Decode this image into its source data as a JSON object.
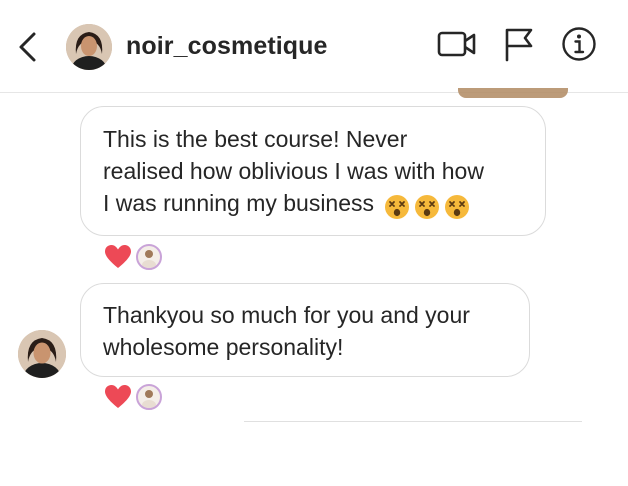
{
  "header": {
    "username": "noir_cosmetique",
    "icons": [
      "back-chevron-icon",
      "video-call-icon",
      "flag-icon",
      "info-icon"
    ]
  },
  "messages": [
    {
      "lines": [
        "This is the best course! Never",
        "realised how oblivious I was with how",
        "I was running my business"
      ],
      "emoji": [
        "dizzy-face-emoji",
        "dizzy-face-emoji",
        "dizzy-face-emoji"
      ],
      "reactions": [
        "heart-icon",
        "reactor-avatar"
      ]
    },
    {
      "lines": [
        "Thankyou so much for you and your",
        "wholesome personality!"
      ],
      "reactions": [
        "heart-icon",
        "reactor-avatar"
      ]
    }
  ],
  "colors": {
    "heart": "#ed4956",
    "bubble_border": "#dbdbdb",
    "text": "#262626",
    "emoji": "#f6b93b"
  }
}
